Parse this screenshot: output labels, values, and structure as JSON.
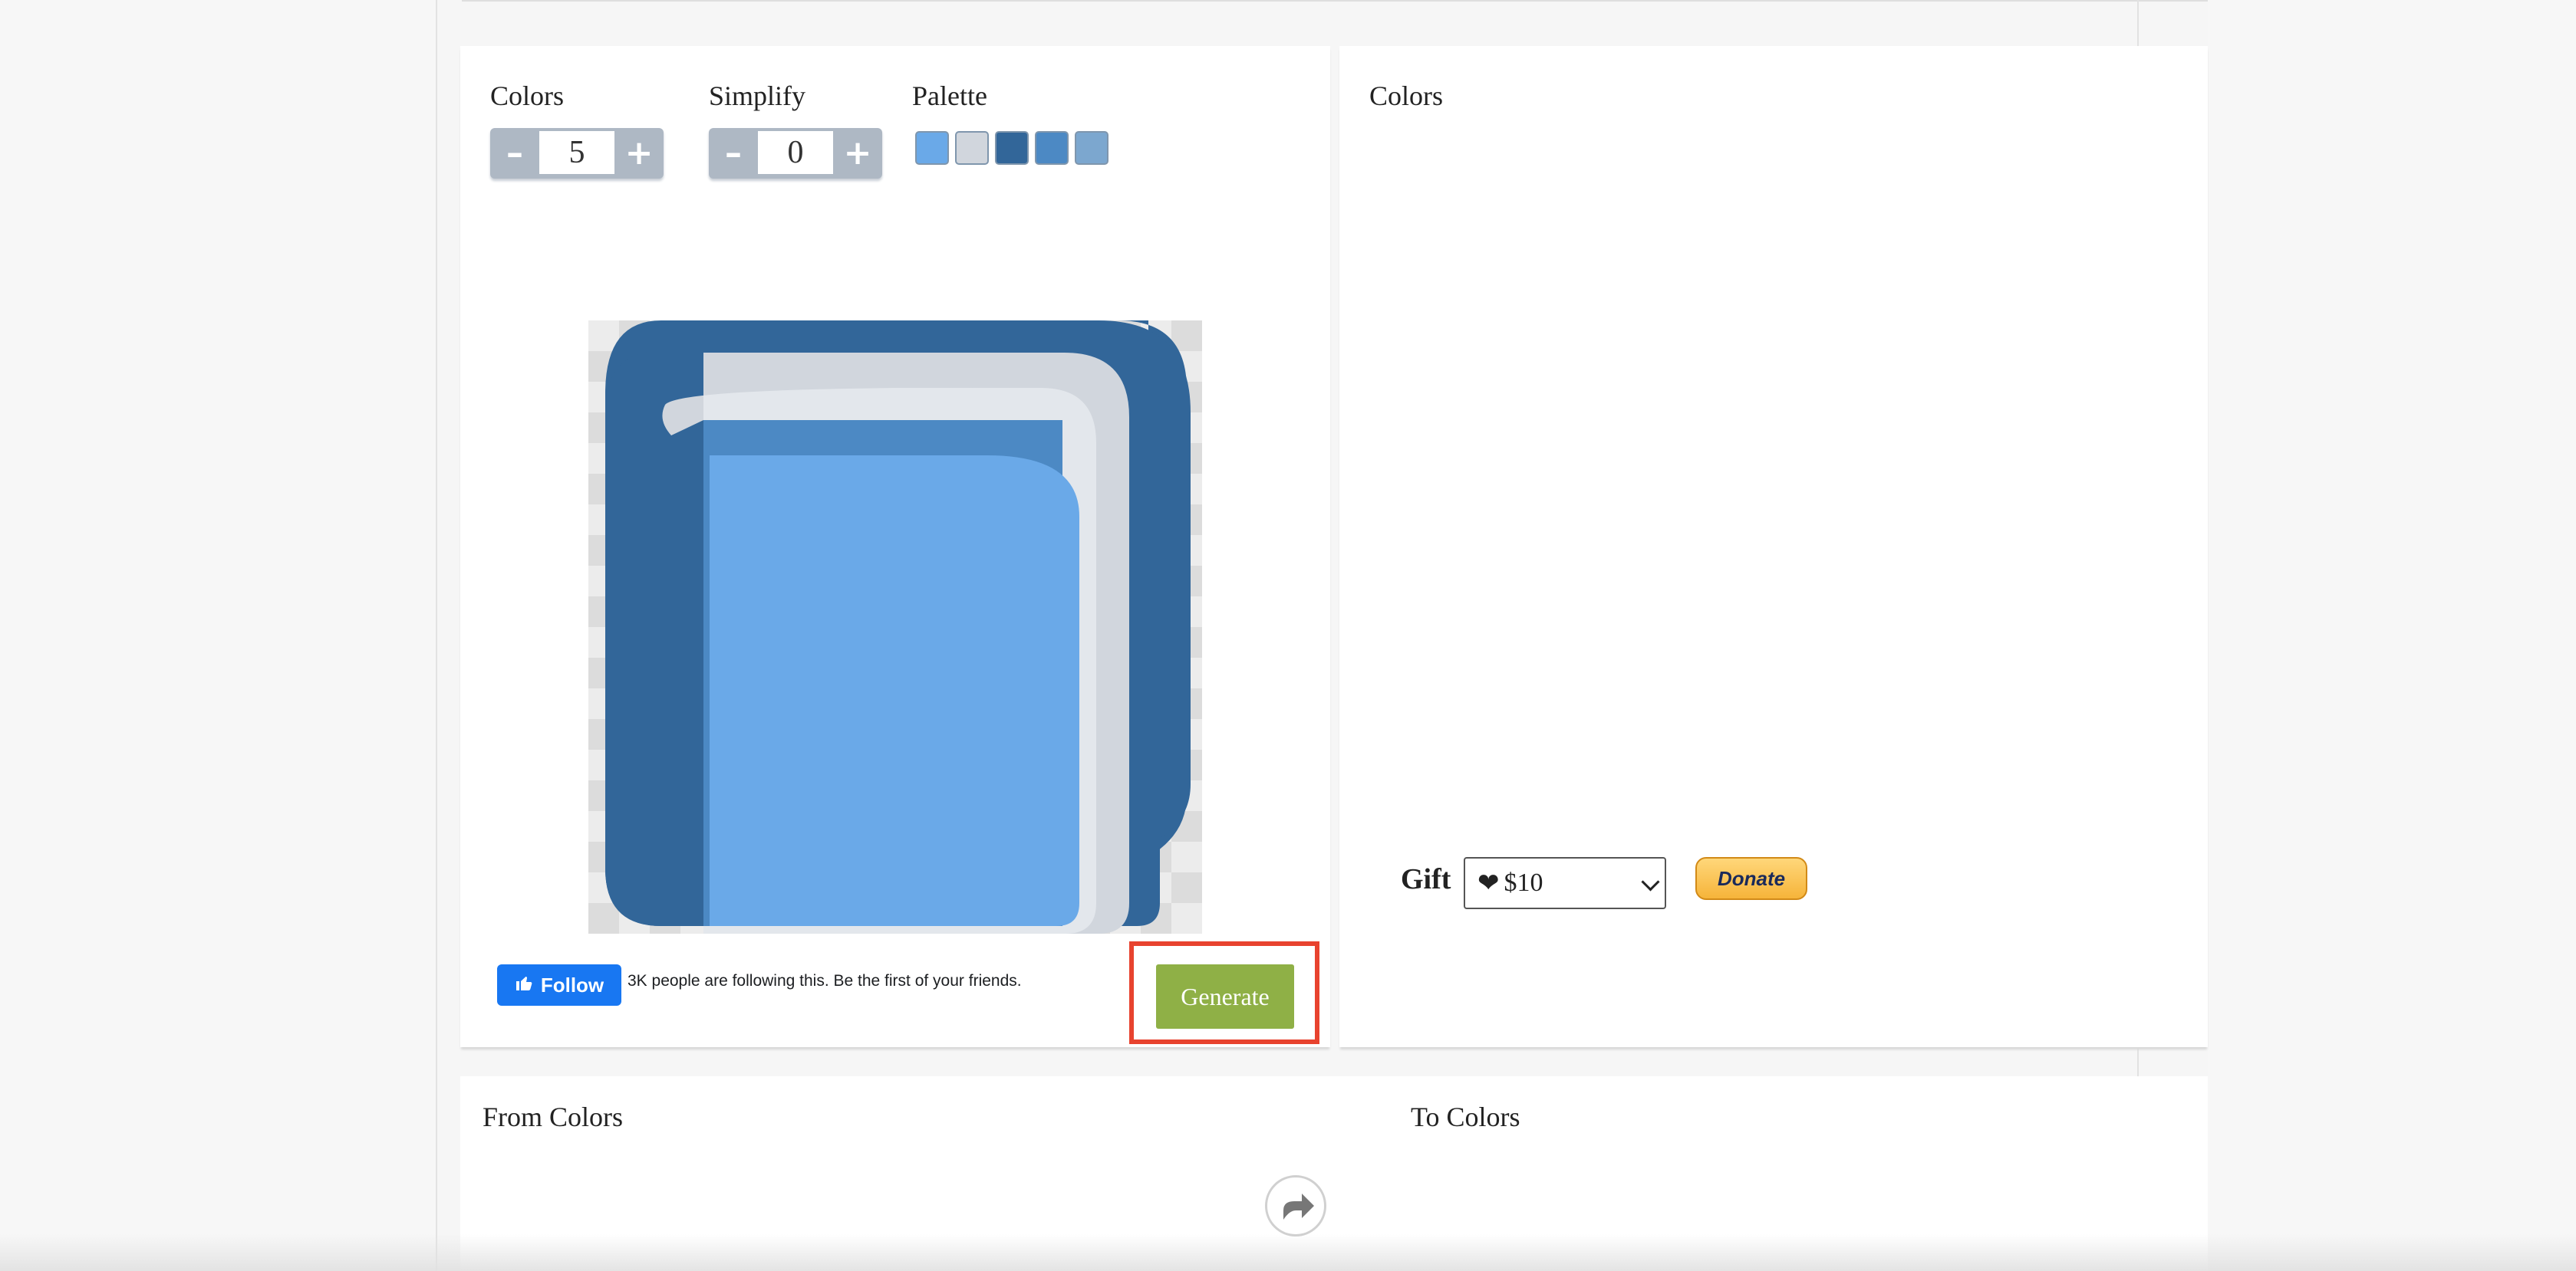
{
  "controls": {
    "colors_label": "Colors",
    "colors_value": "5",
    "simplify_label": "Simplify",
    "simplify_value": "0",
    "palette_label": "Palette",
    "minus_symbol": "–",
    "plus_symbol": "+"
  },
  "palette": [
    {
      "name": "swatch-light-blue",
      "color": "#6aa9e8"
    },
    {
      "name": "swatch-light-gray",
      "color": "#d1d6dd"
    },
    {
      "name": "swatch-dark-blue",
      "color": "#326699"
    },
    {
      "name": "swatch-mid-blue",
      "color": "#4c89c4"
    },
    {
      "name": "swatch-soft-blue",
      "color": "#7ca7cf"
    }
  ],
  "social": {
    "follow_label": "Follow",
    "follow_text": "3K people are following this. Be the first of your friends."
  },
  "actions": {
    "generate_label": "Generate"
  },
  "colors_panel": {
    "title": "Colors"
  },
  "gift": {
    "label": "Gift",
    "selected": "$10",
    "heart": "❤",
    "donate_label": "Donate"
  },
  "bottom": {
    "from_title": "From Colors",
    "to_title": "To Colors"
  },
  "theme": {
    "generate_color": "#8fb046",
    "highlight_color": "#e8432f",
    "facebook_color": "#1877f2"
  }
}
